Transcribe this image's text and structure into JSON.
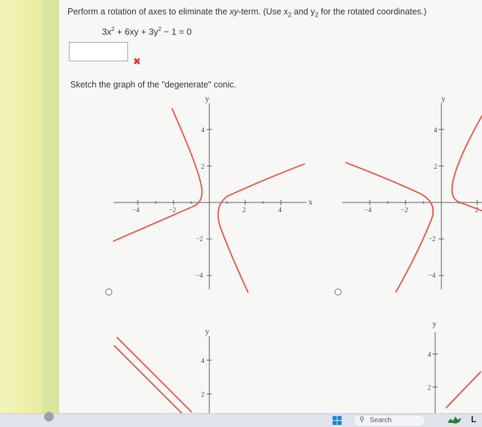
{
  "question": {
    "prefix": "Perform a rotation of axes to eliminate the ",
    "xy_term": "xy",
    "suffix": "-term. (Use x",
    "sub1": "2",
    "mid": " and y",
    "sub2": "2",
    "end": " for the rotated coordinates.)"
  },
  "equation": {
    "t1": "3x",
    "t1sup": "2",
    "t2": " + 6xy + 3y",
    "t2sup": "2",
    "t3": " − 1 = 0"
  },
  "answer": {
    "value": "",
    "status_mark": "✖"
  },
  "sketch_prompt": "Sketch the graph of the \"degenerate\" conic.",
  "graphs": {
    "axis_y": "y",
    "axis_x": "x",
    "ticks_neg": [
      "−4",
      "−2"
    ],
    "ticks_pos": [
      "2",
      "4"
    ],
    "yticks_pos": [
      "4",
      "2"
    ],
    "yticks_neg": [
      "−2",
      "−4"
    ]
  },
  "taskbar": {
    "search_placeholder": "Search",
    "search_icon": "search-icon",
    "start_icon": "windows-start-icon",
    "tray_letter": "L"
  },
  "colors": {
    "curve": "#e05a4c",
    "wrong": "#d63a2c"
  }
}
